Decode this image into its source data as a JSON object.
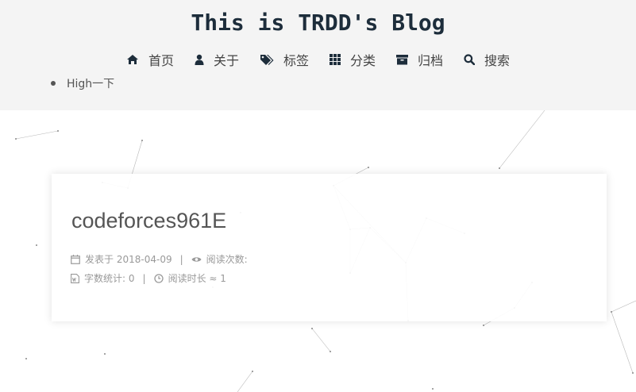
{
  "header": {
    "site_title": "This is TRDD's Blog",
    "menu": [
      {
        "label": "首页",
        "icon": "home-icon"
      },
      {
        "label": "关于",
        "icon": "user-icon"
      },
      {
        "label": "标签",
        "icon": "tags-icon"
      },
      {
        "label": "分类",
        "icon": "grid-icon"
      },
      {
        "label": "归档",
        "icon": "archive-icon"
      },
      {
        "label": "搜索",
        "icon": "search-icon"
      }
    ],
    "sub_item": "High一下"
  },
  "post": {
    "title": "codeforces961E",
    "posted_label": "发表于",
    "posted_date": "2018-04-09",
    "views_label": "阅读次数:",
    "wordcount_label": "字数统计:",
    "wordcount": "0",
    "readtime_label": "阅读时长 ≈",
    "readtime": "1"
  },
  "colors": {
    "header_bg": "#f4f4f4",
    "title": "#1d2d3b",
    "text": "#555555",
    "meta": "#999999"
  }
}
